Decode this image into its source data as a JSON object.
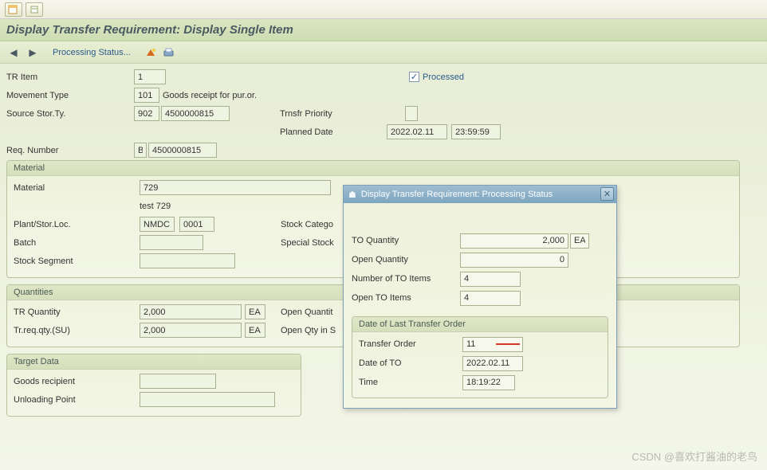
{
  "header": {
    "page_title": "Display Transfer Requirement: Display Single Item",
    "processing_status_link": "Processing Status..."
  },
  "top": {
    "tr_item_label": "TR Item",
    "tr_item_value": "1",
    "processed_label": "Processed",
    "movement_type_label": "Movement Type",
    "movement_type_value": "101",
    "movement_type_desc": "Goods receipt for pur.or.",
    "source_stor_ty_label": "Source Stor.Ty.",
    "source_stor_ty_value": "902",
    "source_stor_ty_doc": "4500000815",
    "trnsfr_priority_label": "Trnsfr Priority",
    "trnsfr_priority_value": "",
    "planned_date_label": "Planned Date",
    "planned_date_value": "2022.02.11",
    "planned_time_value": "23:59:59",
    "req_number_label": "Req. Number",
    "req_number_type": "B",
    "req_number_value": "4500000815"
  },
  "material": {
    "group_title": "Material",
    "material_label": "Material",
    "material_value": "729",
    "material_desc": "test 729",
    "plant_stor_label": "Plant/Stor.Loc.",
    "plant_value": "NMDC",
    "stor_loc_value": "0001",
    "stock_cat_label": "Stock Catego",
    "batch_label": "Batch",
    "batch_value": "",
    "special_stock_label": "Special Stock",
    "stock_segment_label": "Stock Segment",
    "stock_segment_value": ""
  },
  "quantities": {
    "group_title": "Quantities",
    "tr_qty_label": "TR Quantity",
    "tr_qty_value": "2,000",
    "tr_qty_uom": "EA",
    "open_qty_label": "Open Quantit",
    "tr_req_su_label": "Tr.req.qty.(SU)",
    "tr_req_su_value": "2,000",
    "tr_req_su_uom": "EA",
    "open_qty_su_label": "Open Qty in S"
  },
  "target": {
    "group_title": "Target Data",
    "goods_recipient_label": "Goods recipient",
    "goods_recipient_value": "",
    "unloading_point_label": "Unloading Point",
    "unloading_point_value": ""
  },
  "popup": {
    "title": "Display Transfer Requirement: Processing Status",
    "to_qty_label": "TO Quantity",
    "to_qty_value": "2,000",
    "to_qty_uom": "EA",
    "open_qty_label": "Open Quantity",
    "open_qty_value": "0",
    "num_to_items_label": "Number of TO Items",
    "num_to_items_value": "4",
    "open_to_items_label": "Open TO Items",
    "open_to_items_value": "4",
    "date_group_title": "Date of Last Transfer Order",
    "transfer_order_label": "Transfer Order",
    "transfer_order_value": "11",
    "date_of_to_label": "Date of TO",
    "date_of_to_value": "2022.02.11",
    "time_label": "Time",
    "time_value": "18:19:22"
  },
  "watermark": "CSDN @喜欢打酱油的老鸟"
}
